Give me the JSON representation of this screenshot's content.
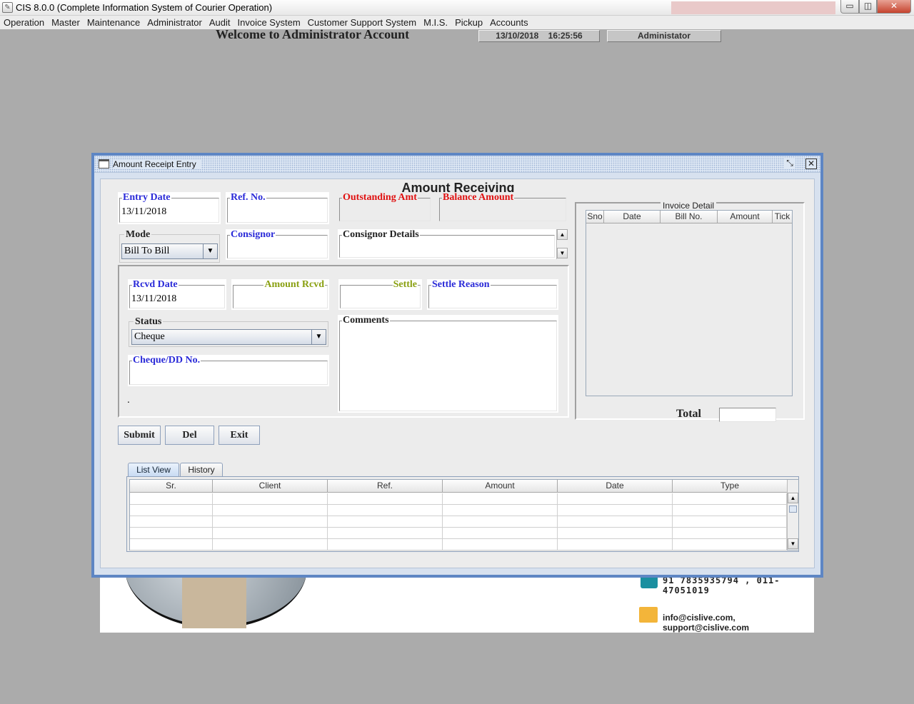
{
  "window": {
    "title": "CIS 8.0.0 (Complete Information System of Courier Operation)",
    "controls": {
      "minimize": "▭",
      "maximize": "◫",
      "close": "✕"
    }
  },
  "menu": [
    "Operation",
    "Master",
    "Maintenance",
    "Administrator",
    "Audit",
    "Invoice System",
    "Customer Support System",
    "M.I.S.",
    "Pickup",
    "Accounts"
  ],
  "header": {
    "welcome": "Welcome to Administrator Account",
    "date": "13/10/2018",
    "time": "16:25:56",
    "user": "Administator"
  },
  "banner": {
    "phone": "91 7835935794 , 011-47051019",
    "email": "info@cislive.com, support@cislive.com"
  },
  "frame": {
    "title": "Amount Receipt Entry",
    "heading": "Amount Receiving"
  },
  "form": {
    "entry_date": {
      "label": "Entry Date",
      "value": "13/11/2018"
    },
    "ref_no": {
      "label": "Ref. No.",
      "value": ""
    },
    "outstanding_amt": {
      "label": "Outstanding Amt",
      "value": ""
    },
    "balance_amount": {
      "label": "Balance Amount",
      "value": ""
    },
    "mode": {
      "label": "Mode",
      "value": "Bill To Bill"
    },
    "consignor": {
      "label": "Consignor",
      "value": ""
    },
    "consignor_details": {
      "label": "Consignor Details",
      "value": ""
    },
    "rcvd_date": {
      "label": "Rcvd Date",
      "value": "13/11/2018"
    },
    "amount_rcvd": {
      "label": "Amount Rcvd",
      "value": ""
    },
    "settle": {
      "label": "Settle",
      "value": ""
    },
    "settle_reason": {
      "label": "Settle Reason",
      "value": ""
    },
    "status": {
      "label": "Status",
      "value": "Cheque"
    },
    "comments": {
      "label": "Comments",
      "value": ""
    },
    "cheque_dd": {
      "label": "Cheque/DD No.",
      "value": ""
    },
    "dot": "."
  },
  "buttons": {
    "submit": "Submit",
    "del": "Del",
    "exit": "Exit"
  },
  "invoice_detail": {
    "title": "Invoice Detail",
    "columns": [
      "Sno",
      "Date",
      "Bill No.",
      "Amount",
      "Tick"
    ],
    "total_label": "Total",
    "total_value": ""
  },
  "tabs": [
    "List View",
    "History"
  ],
  "list_view": {
    "columns": [
      "Sr.",
      "Client",
      "Ref.",
      "Amount",
      "Date",
      "Type"
    ],
    "row_count": 5
  }
}
